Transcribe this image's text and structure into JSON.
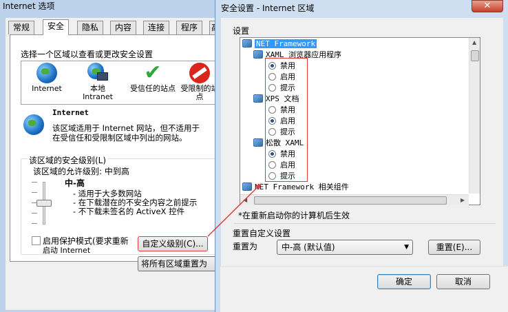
{
  "options_window": {
    "title": "Internet 选项",
    "tabs": [
      "常规",
      "安全",
      "隐私",
      "内容",
      "连接",
      "程序",
      "高"
    ],
    "active_tab": "安全",
    "zone_prompt": "选择一个区域以查看或更改安全设置",
    "zones": [
      {
        "label": "Internet",
        "icon": "globe-icon"
      },
      {
        "label": "本地\nIntranet",
        "icon": "intranet-icon"
      },
      {
        "label": "受信任的站点",
        "icon": "checkmark-icon"
      },
      {
        "label": "受限制的站\n点",
        "icon": "no-entry-icon"
      }
    ],
    "zone_title": "Internet",
    "zone_desc_line1": "该区域适用于 Internet 网站，但不适用于",
    "zone_desc_line2": "在受信任和受限制区域中列出的网站。",
    "level_group_title": "该区域的安全级别(L)",
    "allowed_level": "该区域的允许级别: 中到高",
    "level_name": "中-高",
    "level_bullets": [
      "- 适用于大多数网站",
      "- 在下载潜在的不安全内容之前提示",
      "- 不下载未签名的 ActiveX 控件"
    ],
    "protected_mode_line1": "启用保护模式(要求重新",
    "protected_mode_line2": "启动 Internet",
    "custom_level_button": "自定义级别(C)...",
    "reset_all_button": "将所有区域重置为"
  },
  "security_window": {
    "title": "安全设置 - Internet 区域",
    "close_glyph": "✕",
    "settings_label": "设置",
    "tree": [
      {
        "kind": "category",
        "text": "NET Framework",
        "selected": true
      },
      {
        "kind": "item",
        "text": "XAML 浏览器应用程序"
      },
      {
        "kind": "radio",
        "text": "禁用",
        "checked": true
      },
      {
        "kind": "radio",
        "text": "启用",
        "checked": false
      },
      {
        "kind": "radio",
        "text": "提示",
        "checked": false
      },
      {
        "kind": "item",
        "text": "XPS 文档"
      },
      {
        "kind": "radio",
        "text": "禁用",
        "checked": false
      },
      {
        "kind": "radio",
        "text": "启用",
        "checked": true
      },
      {
        "kind": "radio",
        "text": "提示",
        "checked": false
      },
      {
        "kind": "item",
        "text": "松散 XAML"
      },
      {
        "kind": "radio",
        "text": "禁用",
        "checked": true
      },
      {
        "kind": "radio",
        "text": "启用",
        "checked": false
      },
      {
        "kind": "radio",
        "text": "提示",
        "checked": false
      },
      {
        "kind": "category",
        "text": "NET Framework 相关组件",
        "selected": false
      }
    ],
    "restart_note": "*在重新启动你的计算机后生效",
    "reset_custom_title": "重置自定义设置",
    "reset_to_label": "重置为",
    "reset_level_value": "中-高 (默认值)",
    "reset_button": "重置(E)...",
    "ok_button": "确定",
    "cancel_button": "取消"
  },
  "colors": {
    "selection": "#3399ff",
    "annotation_red": "#e03a3a",
    "title_bar": "#cfdff2"
  }
}
